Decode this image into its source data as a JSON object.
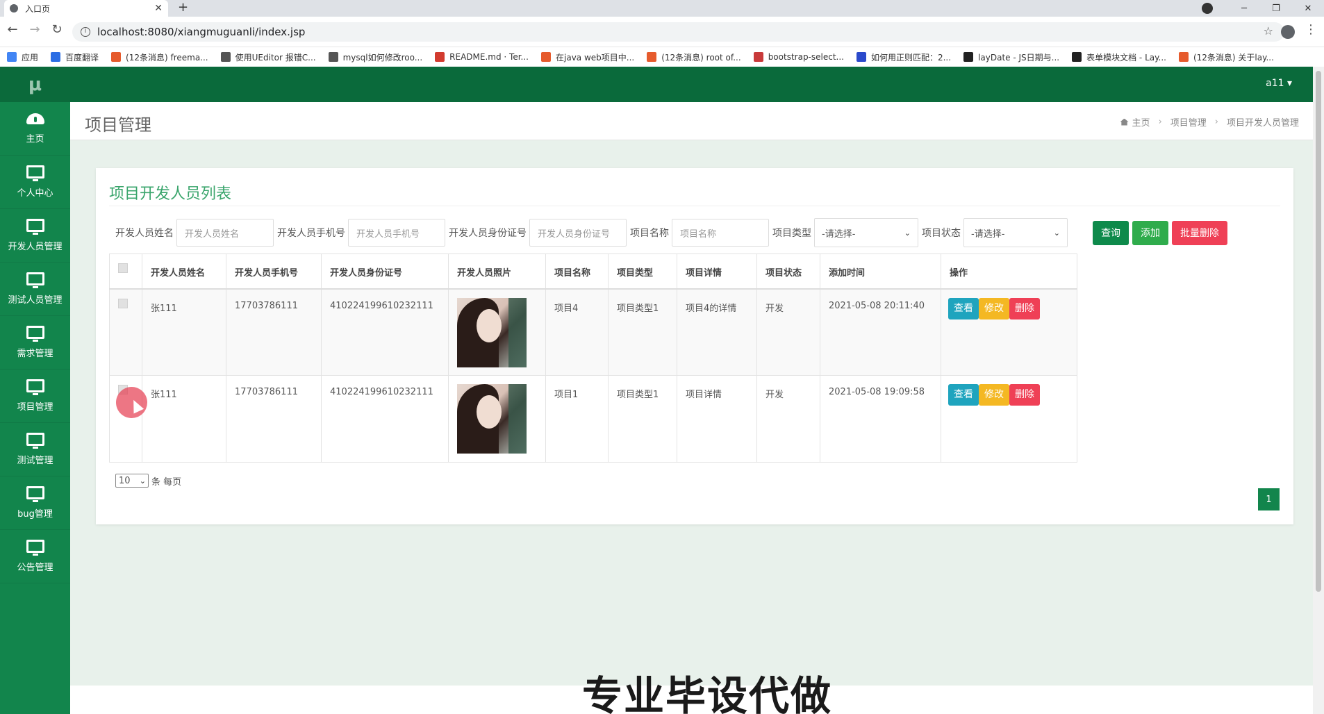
{
  "browser": {
    "tab_title": "入口页",
    "url": "localhost:8080/xiangmuguanli/index.jsp",
    "bookmarks": [
      {
        "label": "应用",
        "color": "#4285f4"
      },
      {
        "label": "百度翻译",
        "color": "#2b6de4"
      },
      {
        "label": "(12条消息) freema...",
        "color": "#e65b2d"
      },
      {
        "label": "使用UEditor 报错C...",
        "color": "#555555"
      },
      {
        "label": "mysql如何修改roo...",
        "color": "#555555"
      },
      {
        "label": "README.md · Ter...",
        "color": "#d23b2f"
      },
      {
        "label": "在java web项目中...",
        "color": "#e65b2d"
      },
      {
        "label": "(12条消息) root of...",
        "color": "#e65b2d"
      },
      {
        "label": "bootstrap-select...",
        "color": "#c83a3a"
      },
      {
        "label": "如何用正则匹配：2...",
        "color": "#2b4acb"
      },
      {
        "label": "layDate - JS日期与...",
        "color": "#222222"
      },
      {
        "label": "表单模块文档 - Lay...",
        "color": "#222222"
      },
      {
        "label": "(12条消息) 关于lay...",
        "color": "#e65b2d"
      }
    ]
  },
  "app": {
    "logo": "μ",
    "user": "a11 ▾",
    "sidebar": [
      {
        "label": "主页",
        "icon": "dashboard-icon"
      },
      {
        "label": "个人中心",
        "icon": "monitor-icon"
      },
      {
        "label": "开发人员管理",
        "icon": "monitor-icon"
      },
      {
        "label": "测试人员管理",
        "icon": "monitor-icon"
      },
      {
        "label": "需求管理",
        "icon": "monitor-icon"
      },
      {
        "label": "项目管理",
        "icon": "monitor-icon"
      },
      {
        "label": "测试管理",
        "icon": "monitor-icon"
      },
      {
        "label": "bug管理",
        "icon": "monitor-icon"
      },
      {
        "label": "公告管理",
        "icon": "monitor-icon"
      }
    ],
    "page_title": "项目管理",
    "breadcrumb": [
      "主页",
      "项目管理",
      "项目开发人员管理"
    ]
  },
  "panel": {
    "title": "项目开发人员列表",
    "filters": {
      "name_label": "开发人员姓名",
      "name_placeholder": "开发人员姓名",
      "phone_label": "开发人员手机号",
      "phone_placeholder": "开发人员手机号",
      "id_label": "开发人员身份证号",
      "id_placeholder": "开发人员身份证号",
      "project_label": "项目名称",
      "project_placeholder": "项目名称",
      "type_label": "项目类型",
      "type_value": "-请选择-",
      "status_label": "项目状态",
      "status_value": "-请选择-"
    },
    "buttons": {
      "query": "查询",
      "add": "添加",
      "batch_delete": "批量删除"
    },
    "columns": [
      "开发人员姓名",
      "开发人员手机号",
      "开发人员身份证号",
      "开发人员照片",
      "项目名称",
      "项目类型",
      "项目详情",
      "项目状态",
      "添加时间",
      "操作"
    ],
    "rows": [
      {
        "name": "张111",
        "phone": "17703786111",
        "id_card": "410224199610232111",
        "project": "项目4",
        "type": "项目类型1",
        "detail": "项目4的详情",
        "status": "开发",
        "time": "2021-05-08 20:11:40"
      },
      {
        "name": "张111",
        "phone": "17703786111",
        "id_card": "410224199610232111",
        "project": "项目1",
        "type": "项目类型1",
        "detail": "项目详情",
        "status": "开发",
        "time": "2021-05-08 19:09:58"
      }
    ],
    "actions": {
      "view": "查看",
      "edit": "修改",
      "delete": "删除"
    },
    "page_size": "10",
    "page_size_suffix": "条 每页",
    "current_page": "1"
  },
  "watermark": "专业毕设代做"
}
